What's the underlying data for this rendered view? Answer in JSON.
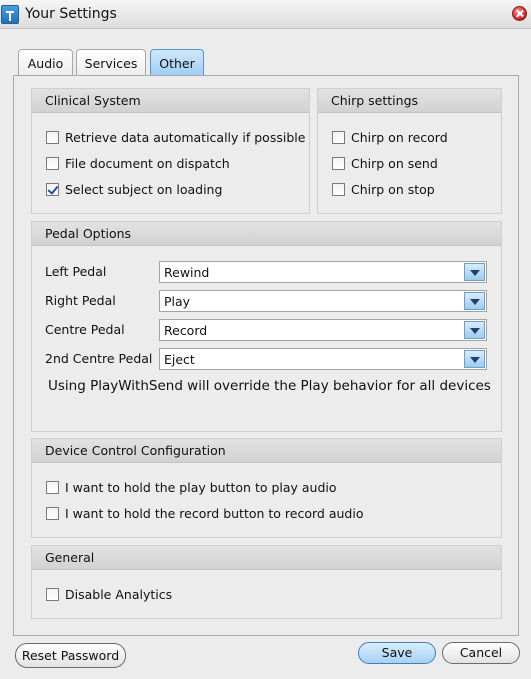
{
  "window": {
    "title": "Your Settings"
  },
  "tabs": [
    {
      "label": "Audio"
    },
    {
      "label": "Services"
    },
    {
      "label": "Other",
      "active": true
    }
  ],
  "clinical_system": {
    "title": "Clinical System",
    "items": [
      {
        "label": "Retrieve data automatically if possible",
        "checked": false
      },
      {
        "label": "File document on dispatch",
        "checked": false
      },
      {
        "label": "Select subject on loading",
        "checked": true
      }
    ]
  },
  "chirp_settings": {
    "title": "Chirp settings",
    "items": [
      {
        "label": "Chirp on record",
        "checked": false
      },
      {
        "label": "Chirp on send",
        "checked": false
      },
      {
        "label": "Chirp on stop",
        "checked": false
      }
    ]
  },
  "pedal_options": {
    "title": "Pedal Options",
    "rows": [
      {
        "label": "Left Pedal",
        "value": "Rewind"
      },
      {
        "label": "Right Pedal",
        "value": "Play"
      },
      {
        "label": "Centre Pedal",
        "value": "Record"
      },
      {
        "label": "2nd Centre Pedal",
        "value": "Eject"
      }
    ],
    "notice": "Using PlayWithSend will override the Play behavior for all devices"
  },
  "device_control": {
    "title": "Device Control Configuration",
    "items": [
      {
        "label": "I want to hold the play button to play audio",
        "checked": false
      },
      {
        "label": "I want to hold the record button to record audio",
        "checked": false
      }
    ]
  },
  "general": {
    "title": "General",
    "items": [
      {
        "label": "Disable Analytics",
        "checked": false
      }
    ]
  },
  "buttons": {
    "reset_password": "Reset Password",
    "save": "Save",
    "cancel": "Cancel"
  },
  "colors": {
    "active_tab": "#9fcdf3",
    "close_button": "#c81e1e",
    "primary_button": "#a6d0f3"
  }
}
